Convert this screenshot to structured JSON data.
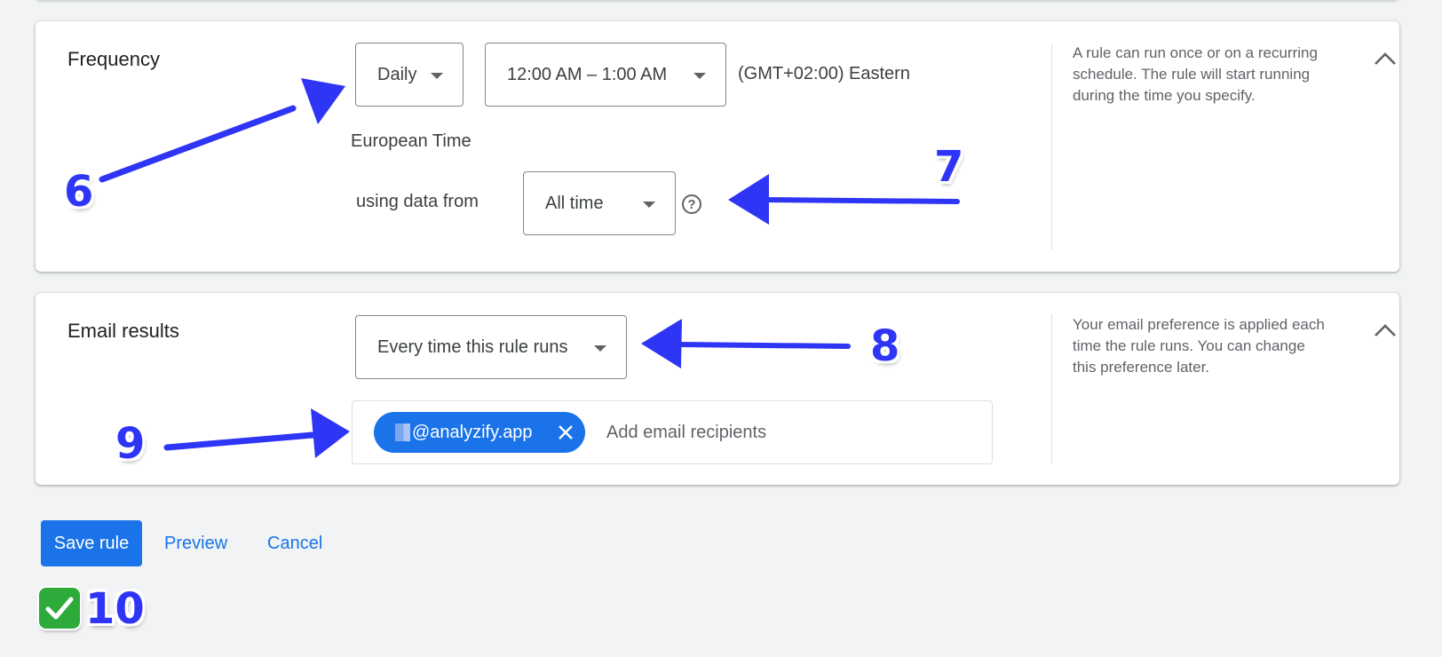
{
  "frequency": {
    "title": "Frequency",
    "schedule_value": "Daily",
    "time_range_value": "12:00 AM – 1:00 AM",
    "timezone_line1": "(GMT+02:00) Eastern",
    "timezone_line2": "European Time",
    "using_data_label": "using data from",
    "data_range_value": "All time",
    "help_icon": "help-circle-icon",
    "helper_text": "A rule can run once or on a recurring schedule. The rule will start running during the time you specify.",
    "collapse_icon": "chevron-up-icon"
  },
  "email_results": {
    "title": "Email results",
    "frequency_value": "Every time this rule runs",
    "recipient_chip": "@analyzify.app",
    "recipient_remove_icon": "close-icon",
    "recipients_placeholder": "Add email recipients",
    "helper_text": "Your email preference is applied each time the rule runs. You can change this preference later.",
    "collapse_icon": "chevron-up-icon"
  },
  "actions": {
    "save_label": "Save rule",
    "preview_label": "Preview",
    "cancel_label": "Cancel"
  },
  "annotations": {
    "step6": "6",
    "step7": "7",
    "step8": "8",
    "step9": "9",
    "step10": "10",
    "check_icon": "check-mark-icon",
    "arrow_color": "#2f35f5"
  },
  "colors": {
    "primary": "#1a73e8",
    "background": "#f1f3f4",
    "success": "#2eaa3a"
  }
}
